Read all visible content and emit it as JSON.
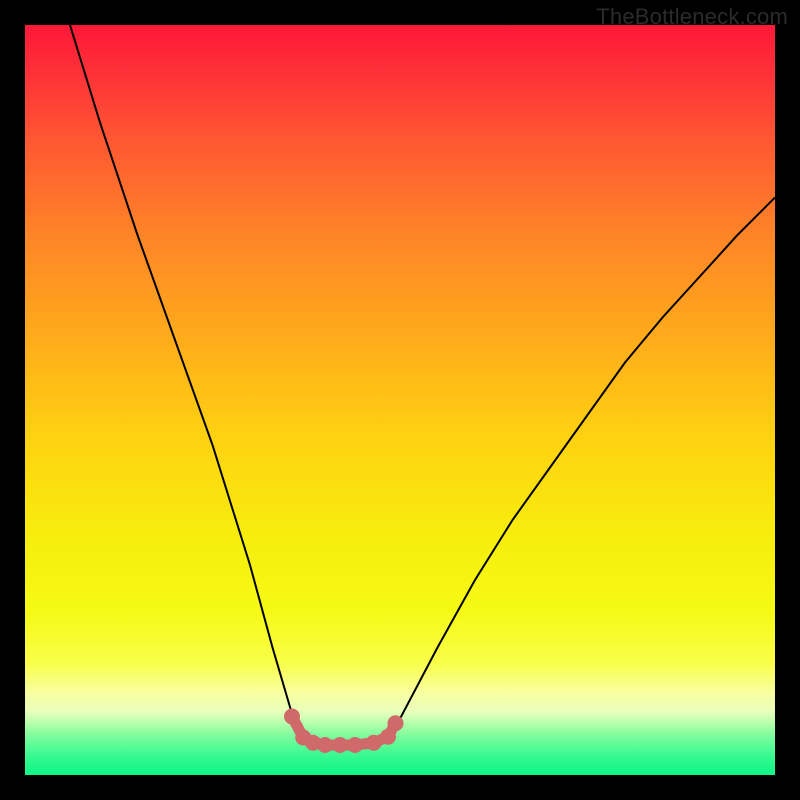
{
  "watermark": "TheBottleneck.com",
  "chart_data": {
    "type": "line",
    "title": "",
    "xlabel": "",
    "ylabel": "",
    "xlim": [
      0,
      100
    ],
    "ylim": [
      0,
      100
    ],
    "grid": false,
    "series": [
      {
        "name": "bottleneck-curve",
        "x": [
          6,
          10,
          15,
          20,
          25,
          30,
          33,
          35.5,
          37,
          38.5,
          40,
          42,
          44,
          46,
          48,
          50,
          55,
          60,
          65,
          70,
          75,
          80,
          85,
          90,
          95,
          100
        ],
        "y": [
          100,
          87,
          72,
          58,
          44,
          28,
          17,
          8.5,
          5.2,
          4.3,
          4.0,
          4.0,
          4.0,
          4.3,
          5.0,
          7.5,
          17,
          26,
          34,
          41,
          48,
          55,
          61,
          66.5,
          72,
          77
        ]
      }
    ],
    "flat_zone": {
      "x_start": 35.5,
      "x_end": 49.5,
      "y": 4.2,
      "points": [
        {
          "x": 35.6,
          "y": 7.8
        },
        {
          "x": 37.1,
          "y": 5.0
        },
        {
          "x": 38.4,
          "y": 4.3
        },
        {
          "x": 40.0,
          "y": 4.0
        },
        {
          "x": 42.0,
          "y": 4.0
        },
        {
          "x": 44.0,
          "y": 4.0
        },
        {
          "x": 46.5,
          "y": 4.3
        },
        {
          "x": 48.4,
          "y": 5.1
        },
        {
          "x": 49.4,
          "y": 6.9
        }
      ],
      "color": "#d06969"
    },
    "gradient_stops": [
      {
        "pos": 0.0,
        "color": "#fe1838"
      },
      {
        "pos": 0.15,
        "color": "#ff5633"
      },
      {
        "pos": 0.42,
        "color": "#ffac1b"
      },
      {
        "pos": 0.68,
        "color": "#f7ed0d"
      },
      {
        "pos": 0.85,
        "color": "#f9ff48"
      },
      {
        "pos": 0.93,
        "color": "#b9ffad"
      },
      {
        "pos": 1.0,
        "color": "#0ef688"
      }
    ]
  }
}
